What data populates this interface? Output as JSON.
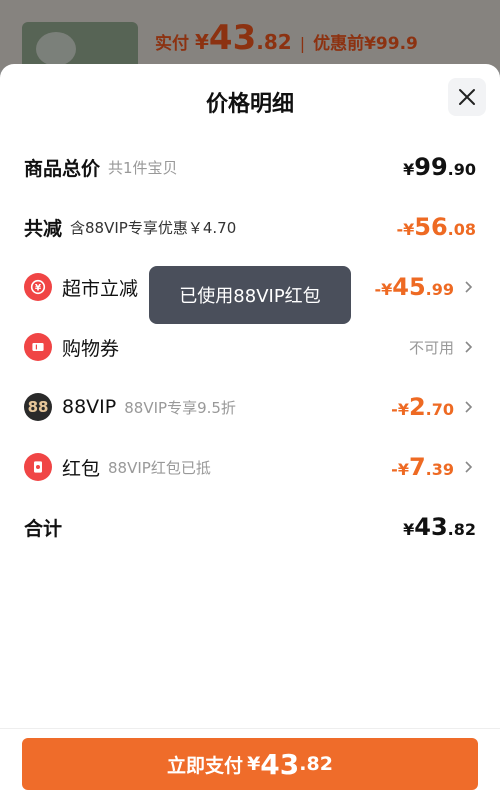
{
  "header_bg": {
    "pay_label": "实付",
    "currency": "¥",
    "pay_int": "43",
    "pay_dec": ".82",
    "separator": "|",
    "original_price": "优惠前¥99.9"
  },
  "sheet": {
    "title": "价格明细",
    "close_icon": "close-icon"
  },
  "rows": {
    "total": {
      "label": "商品总价",
      "sub": "共1件宝贝",
      "pre": "¥",
      "int": "99",
      "dec": ".90"
    },
    "reduce": {
      "label": "共减",
      "sub": "含88VIP专享优惠￥4.70",
      "pre": "-¥",
      "int": "56",
      "dec": ".08"
    },
    "market": {
      "label": "超市立减",
      "pre": "-¥",
      "int": "45",
      "dec": ".99",
      "icon": "yen-coupon-icon"
    },
    "coupon": {
      "label": "购物券",
      "status": "不可用",
      "icon": "ticket-icon"
    },
    "vip": {
      "label": "88VIP",
      "sub": "88VIP专享9.5折",
      "pre": "-¥",
      "int": "2",
      "dec": ".70",
      "icon_text": "88"
    },
    "redpacket": {
      "label": "红包",
      "sub": "88VIP红包已抵",
      "pre": "-¥",
      "int": "7",
      "dec": ".39",
      "icon": "red-envelope-icon"
    },
    "sum": {
      "label": "合计",
      "pre": "¥",
      "int": "43",
      "dec": ".82"
    }
  },
  "tooltip": "已使用88VIP红包",
  "pay_button": {
    "label": "立即支付",
    "yen": "¥",
    "int": "43",
    "dec": ".82"
  },
  "colors": {
    "accent": "#ef6c2a",
    "price_orange": "#ee6a23",
    "icon_red": "#f04545",
    "tooltip_bg": "#4a4f5b"
  }
}
